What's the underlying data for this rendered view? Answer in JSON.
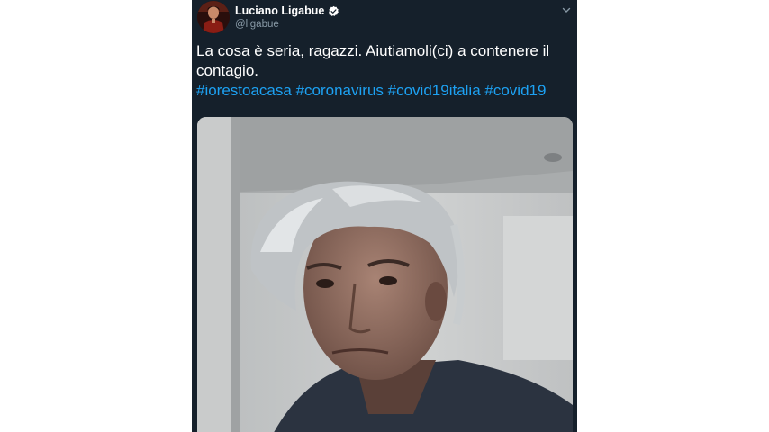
{
  "tweet": {
    "author_name": "Luciano Ligabue",
    "author_handle": "@ligabue",
    "text": "La cosa è seria, ragazzi. Aiutiamoli(ci) a contenere il contagio.",
    "hashtags": [
      "#iorestoacasa",
      "#coronavirus",
      "#covid19italia",
      "#covid19"
    ]
  },
  "colors": {
    "background": "#15202b",
    "text": "#ffffff",
    "secondary_text": "#8899a6",
    "link": "#1da1f2",
    "verified_badge": "#ffffff"
  },
  "icons": {
    "verified": "verified-badge-icon",
    "menu": "chevron-down-icon"
  }
}
